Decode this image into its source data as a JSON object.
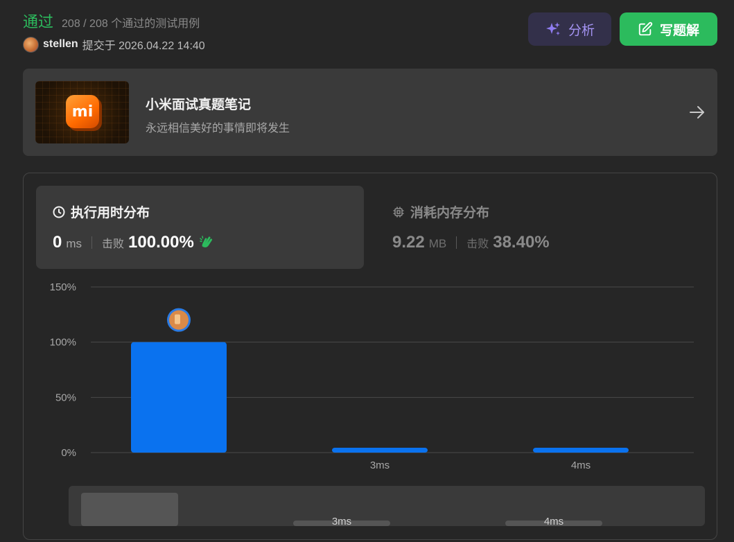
{
  "header": {
    "status": "通过",
    "testcases": "208 / 208 个通过的测试用例",
    "username": "stellen",
    "submitted_at": "提交于 2026.04.22 14:40"
  },
  "actions": {
    "analyze_label": "分析",
    "write_solution_label": "写题解"
  },
  "banner": {
    "logo_text": "mi",
    "title": "小米面试真题笔记",
    "subtitle": "永远相信美好的事情即将发生"
  },
  "tabs": {
    "runtime": {
      "title": "执行用时分布",
      "value": "0",
      "unit": "ms",
      "beats_label": "击败",
      "beats_value": "100.00%"
    },
    "memory": {
      "title": "消耗内存分布",
      "value": "9.22",
      "unit": "MB",
      "beats_label": "击败",
      "beats_value": "38.40%"
    }
  },
  "colors": {
    "accent_green": "#2cbb5d",
    "bar_blue": "#0a72ef",
    "analyze_purple": "#a594f4"
  },
  "chart_data": {
    "type": "bar",
    "categories": [
      "",
      "3ms",
      "4ms"
    ],
    "values": [
      100,
      3,
      3
    ],
    "ylim": [
      0,
      150
    ],
    "yticks": [
      "0%",
      "50%",
      "100%",
      "150%"
    ],
    "ytick_values": [
      0,
      50,
      100,
      150
    ],
    "highlight_index": 0,
    "grid": true,
    "overview": {
      "categories": [
        "",
        "3ms",
        "4ms"
      ],
      "values": [
        100,
        3,
        3
      ]
    }
  }
}
